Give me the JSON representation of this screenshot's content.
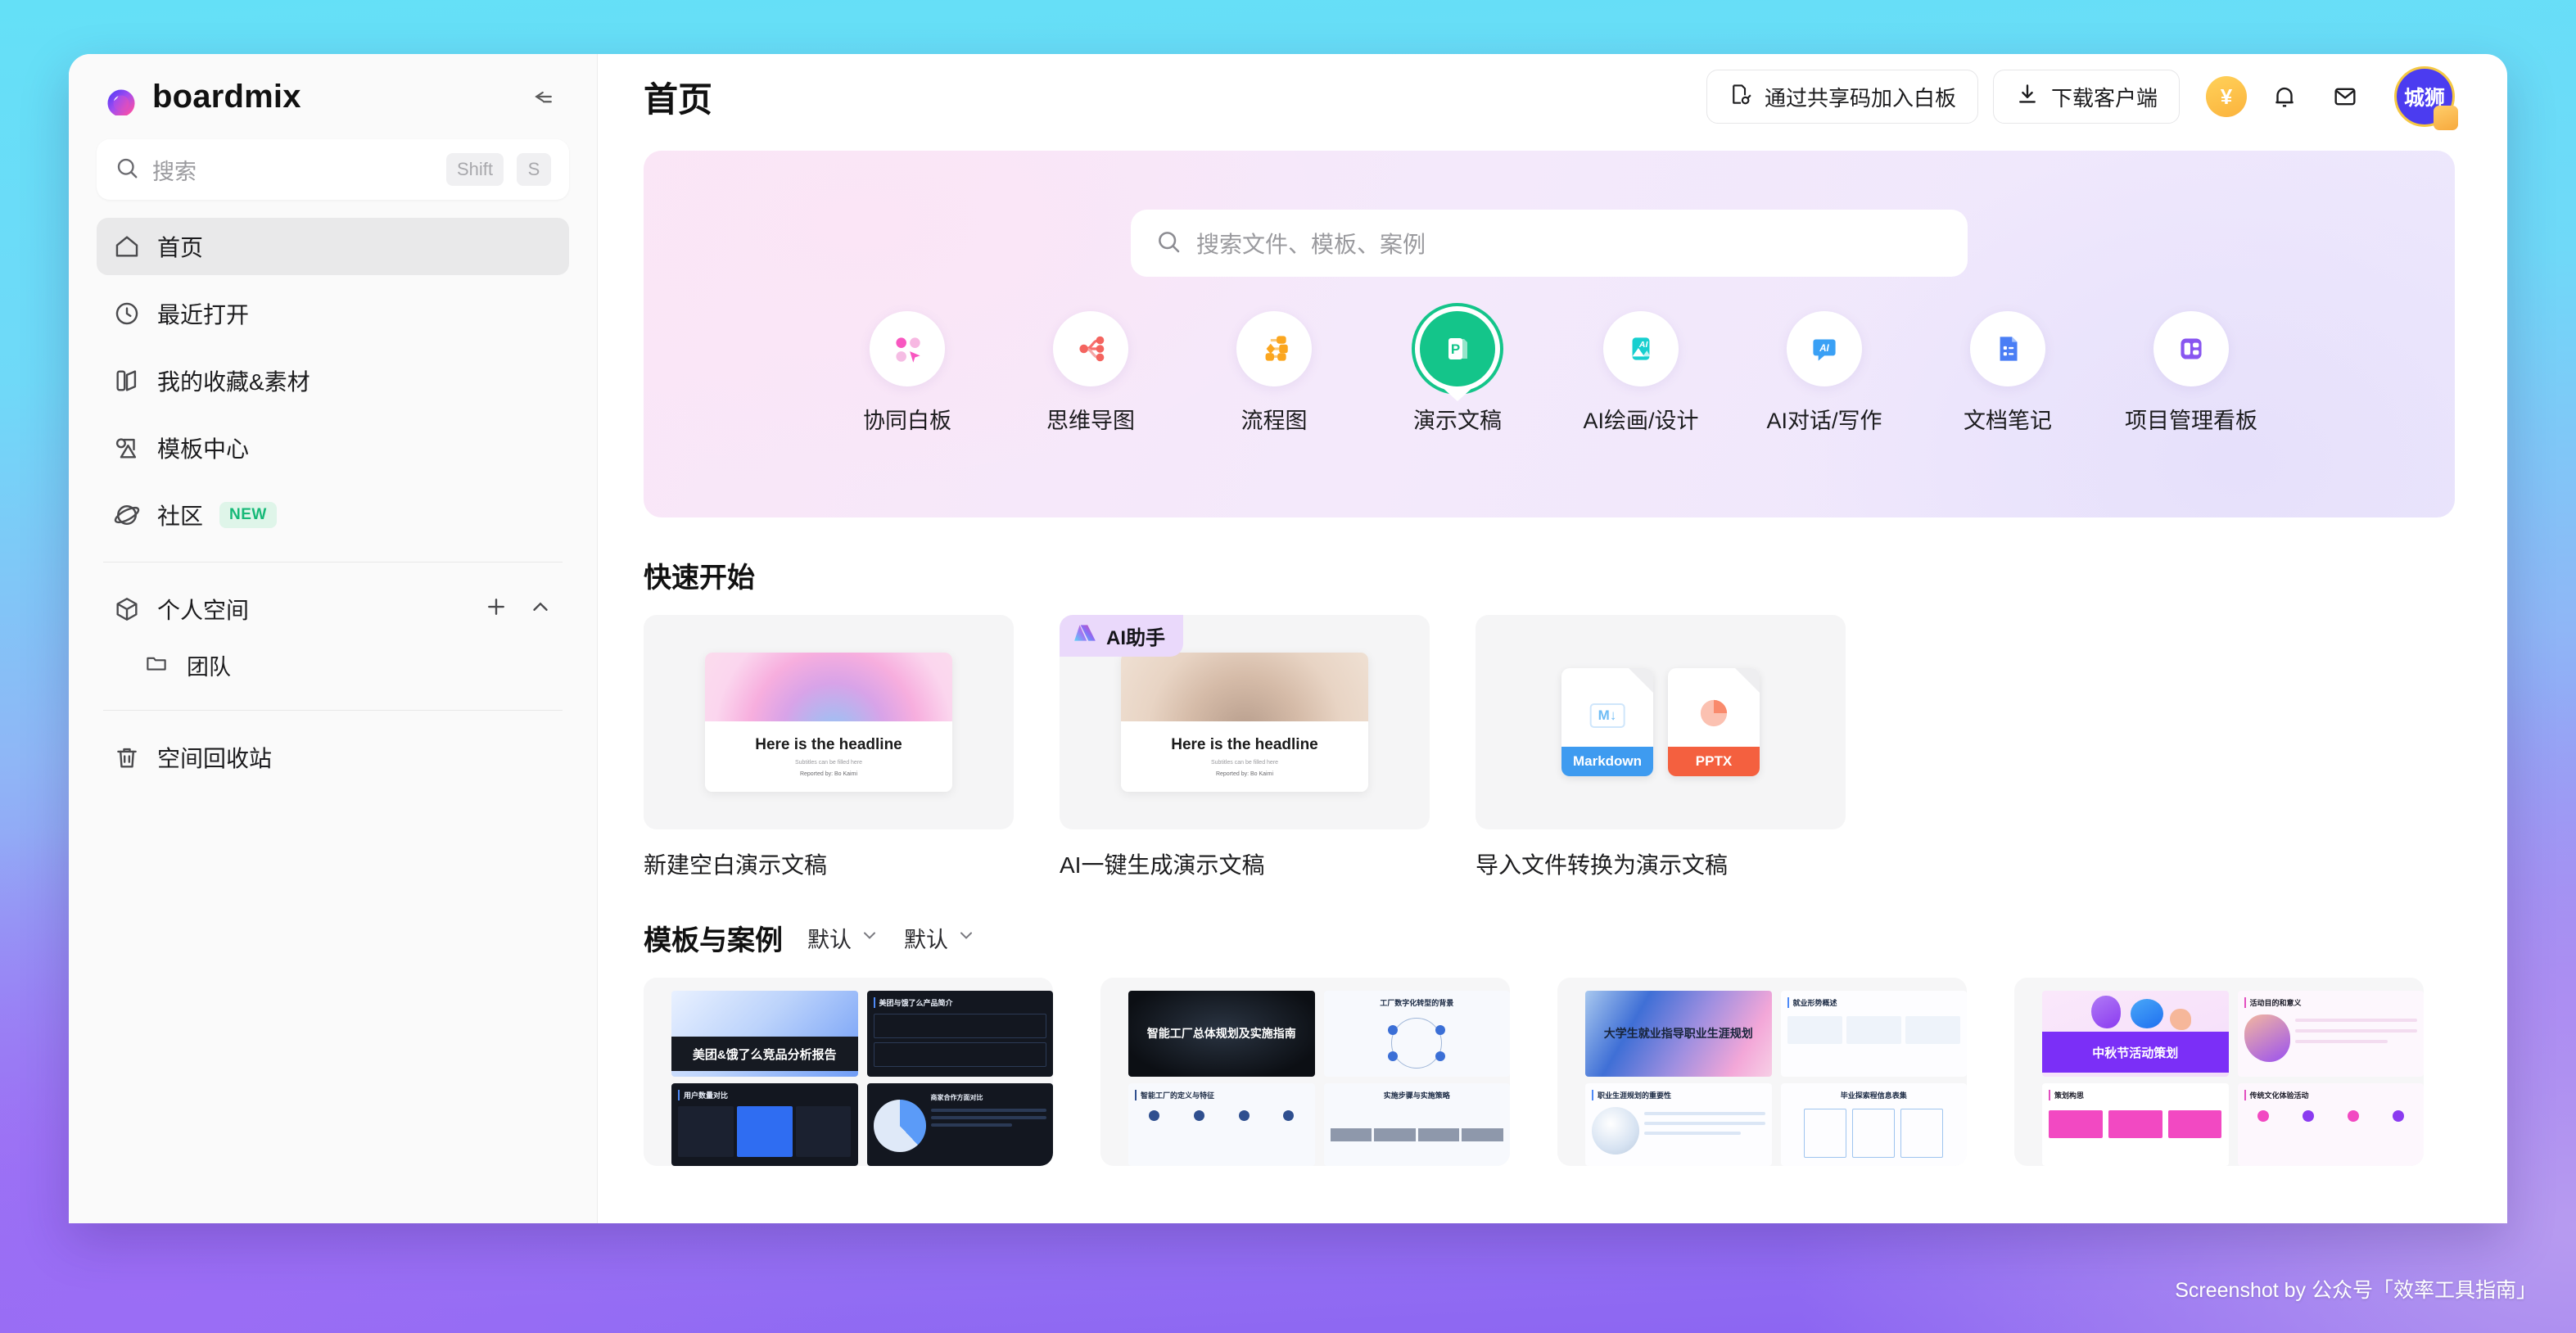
{
  "brand": {
    "name": "boardmix",
    "logo_icon": "boardmix-logo-icon",
    "collapse_icon": "collapse-sidebar-icon"
  },
  "sidebar": {
    "search": {
      "placeholder": "搜索",
      "icon": "search-icon",
      "kbd1": "Shift",
      "kbd2": "S"
    },
    "items": [
      {
        "label": "首页",
        "icon": "home-icon",
        "active": true
      },
      {
        "label": "最近打开",
        "icon": "clock-icon",
        "active": false
      },
      {
        "label": "我的收藏&素材",
        "icon": "bookmark-icon",
        "active": false
      },
      {
        "label": "模板中心",
        "icon": "template-icon",
        "active": false
      },
      {
        "label": "社区",
        "icon": "planet-icon",
        "active": false,
        "badge": "NEW"
      }
    ],
    "space": {
      "label": "个人空间",
      "icon": "cube-icon",
      "add_icon": "plus-icon",
      "collapse_icon": "chevron-up-icon",
      "children": [
        {
          "label": "团队",
          "icon": "folder-icon"
        }
      ]
    },
    "trash": {
      "label": "空间回收站",
      "icon": "trash-icon"
    }
  },
  "header": {
    "title": "首页",
    "join_button": {
      "label": "通过共享码加入白板",
      "icon": "share-code-icon"
    },
    "download_button": {
      "label": "下载客户端",
      "icon": "download-icon"
    },
    "coin": {
      "label": "¥",
      "color": "#fbb33d"
    },
    "bell_icon": "bell-icon",
    "inbox_icon": "inbox-icon",
    "avatar": {
      "name": "城狮",
      "color": "#4b3cf0"
    }
  },
  "hero": {
    "search": {
      "placeholder": "搜索文件、模板、案例",
      "icon": "search-icon"
    },
    "categories": [
      {
        "label": "协同白板",
        "icon": "whiteboard-icon",
        "selected": false
      },
      {
        "label": "思维导图",
        "icon": "mindmap-icon",
        "selected": false
      },
      {
        "label": "流程图",
        "icon": "flowchart-icon",
        "selected": false
      },
      {
        "label": "演示文稿",
        "icon": "presentation-icon",
        "selected": true
      },
      {
        "label": "AI绘画/设计",
        "icon": "ai-design-icon",
        "selected": false
      },
      {
        "label": "AI对话/写作",
        "icon": "ai-chat-icon",
        "selected": false
      },
      {
        "label": "文档笔记",
        "icon": "document-icon",
        "selected": false
      },
      {
        "label": "项目管理看板",
        "icon": "kanban-icon",
        "selected": false
      }
    ]
  },
  "quick_start": {
    "title": "快速开始",
    "cards": [
      {
        "label": "新建空白演示文稿",
        "slide": {
          "headline": "Here is the headline",
          "subtitle": "Subtitles can be filled here",
          "byline": "Reported by:  Bo Kaimi"
        },
        "badge": null
      },
      {
        "label": "AI一键生成演示文稿",
        "slide": {
          "headline": "Here is the headline",
          "subtitle": "Subtitles can be filled here",
          "byline": "Reported by:  Bo Kaimi"
        },
        "badge": {
          "label": "AI助手",
          "icon": "ai-assistant-icon"
        }
      },
      {
        "label": "导入文件转换为演示文稿",
        "files": [
          {
            "tag": "Markdown",
            "color": "#3e9bf0",
            "glyph": "M↓"
          },
          {
            "tag": "PPTX",
            "color": "#f4603f",
            "glyph": "pie"
          }
        ],
        "badge": null
      }
    ]
  },
  "templates": {
    "title": "模板与案例",
    "filters": [
      {
        "value": "默认",
        "caret": "chevron-down-icon"
      },
      {
        "value": "默认",
        "caret": "chevron-down-icon"
      }
    ],
    "cards": [
      {
        "cover_title": "美团&饿了么竞品分析报告",
        "theme": "blue-dark",
        "slides": [
          "美团与饿了么产品简介",
          "用户数量对比",
          "商家合作方面对比"
        ]
      },
      {
        "cover_title": "智能工厂总体规划及实施指南",
        "theme": "dark-wave",
        "slides": [
          "工厂数字化转型的背景",
          "智能工厂的定义与特征",
          "实施步骤与实施策略"
        ]
      },
      {
        "cover_title": "大学生就业指导职业生涯规划",
        "theme": "watercolor",
        "slides": [
          "就业形势概述",
          "职业生涯规划的重要性",
          "毕业探索程信息表集"
        ]
      },
      {
        "cover_title": "中秋节活动策划",
        "theme": "purple-3d",
        "slides": [
          "活动目的和意义",
          "策划构思",
          "传统文化体验活动"
        ]
      }
    ]
  },
  "watermark": "Screenshot by 公众号「效率工具指南」"
}
